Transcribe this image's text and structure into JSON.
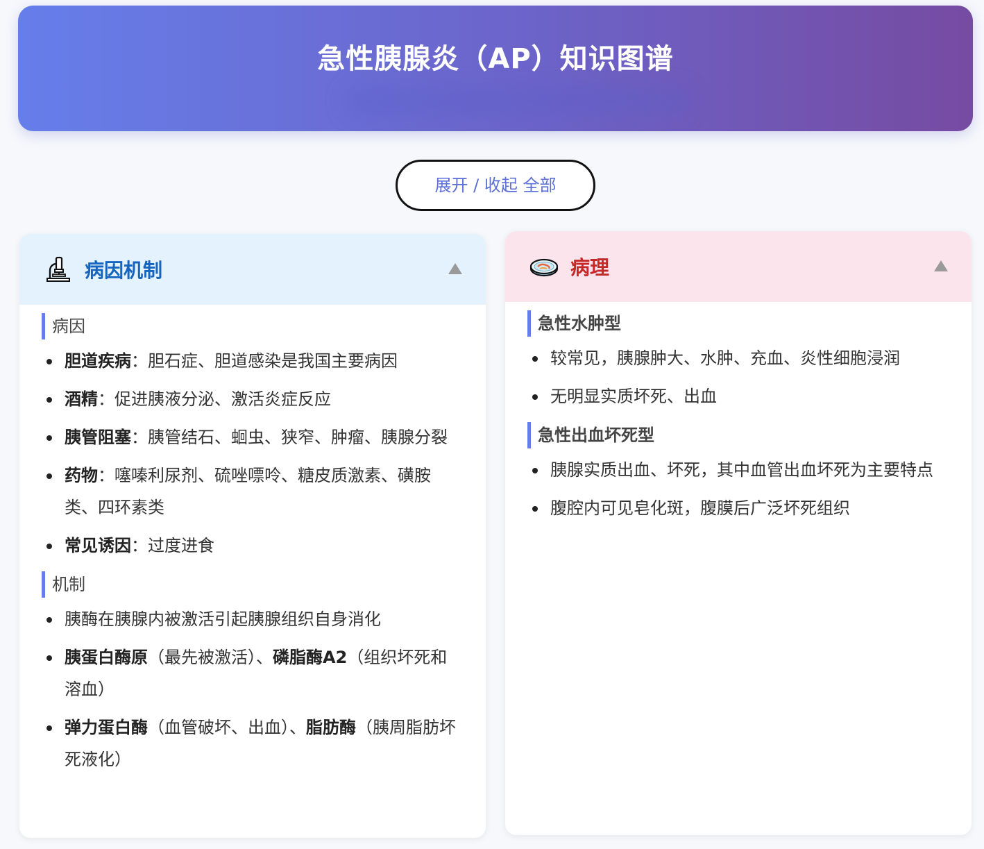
{
  "header": {
    "title": "急性胰腺炎（AP）知识图谱"
  },
  "toggle_all": {
    "label": "展开 / 收起 全部"
  },
  "cards": [
    {
      "title": "病因机制",
      "icon": "microscope-icon",
      "accent": "#1565c0",
      "sections": [
        {
          "heading": "病因",
          "items": [
            {
              "term": "胆道疾病",
              "sep": "：",
              "text": "胆石症、胆道感染是我国主要病因"
            },
            {
              "term": "酒精",
              "sep": "：",
              "text": "促进胰液分泌、激活炎症反应"
            },
            {
              "term": "胰管阻塞",
              "sep": "：",
              "text": "胰管结石、蛔虫、狭窄、肿瘤、胰腺分裂"
            },
            {
              "term": "药物",
              "sep": "：",
              "text": "噻嗪利尿剂、硫唑嘌呤、糖皮质激素、磺胺类、四环素类"
            },
            {
              "term": "常见诱因",
              "sep": "：",
              "text": "过度进食"
            }
          ]
        },
        {
          "heading": "机制",
          "items": [
            {
              "text": "胰酶在胰腺内被激活引起胰腺组织自身消化"
            },
            {
              "term": "胰蛋白酶原",
              "text": "（最先被激活）、",
              "term2": "磷脂酶A2",
              "text2": "（组织坏死和溶血）"
            },
            {
              "term": "弹力蛋白酶",
              "text": "（血管破坏、出血）、",
              "term2": "脂肪酶",
              "text2": "（胰周脂肪坏死液化）"
            }
          ]
        }
      ]
    },
    {
      "title": "病理",
      "icon": "petri-dish-icon",
      "accent": "#c62828",
      "sections": [
        {
          "heading": "急性水肿型",
          "items": [
            {
              "text": "较常见，胰腺肿大、水肿、充血、炎性细胞浸润"
            },
            {
              "text": "无明显实质坏死、出血"
            }
          ]
        },
        {
          "heading": "急性出血坏死型",
          "items": [
            {
              "text": "胰腺实质出血、坏死，其中血管出血坏死为主要特点"
            },
            {
              "text": "腹腔内可见皂化斑，腹膜后广泛坏死组织"
            }
          ]
        }
      ]
    }
  ]
}
